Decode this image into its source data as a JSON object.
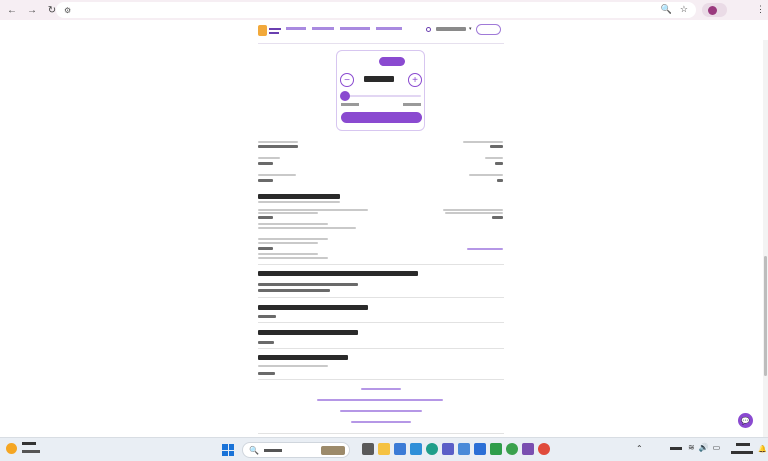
{
  "browser": {
    "url_icon": "tune-icon",
    "back_icon": "←",
    "forward_icon": "→",
    "reload_icon": "↻"
  },
  "calculator": {
    "minus": "−",
    "plus": "+"
  },
  "chat": {
    "icon": "💬"
  },
  "colors": {
    "accent": "#8a4ad0",
    "link": "#7a45c9",
    "browser_bar": "#f6eef3",
    "taskbar": "#e9eef4"
  }
}
